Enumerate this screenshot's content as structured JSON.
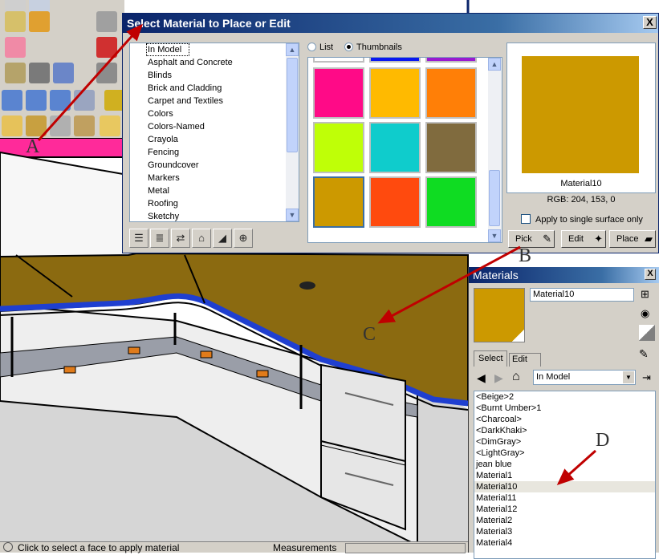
{
  "dialog": {
    "title": "Select Material to Place or Edit",
    "close_label": "X",
    "view_mode": {
      "list_label": "List",
      "thumbnails_label": "Thumbnails",
      "selected": "Thumbnails"
    },
    "categories": [
      "In Model",
      "Asphalt and Concrete",
      "Blinds",
      "Brick and Cladding",
      "Carpet and Textiles",
      "Colors",
      "Colors-Named",
      "Crayola",
      "Fencing",
      "Groundcover",
      "Markers",
      "Metal",
      "Roofing",
      "Sketchy"
    ],
    "selected_category": "In Model",
    "swatches": [
      {
        "color": "#ff0a87"
      },
      {
        "color": "#ffba00"
      },
      {
        "color": "#ff7f07"
      },
      {
        "color": "#bfff07"
      },
      {
        "color": "#0fcccc"
      },
      {
        "color": "#806b3e"
      },
      {
        "color": "#cc9900",
        "selected": true
      },
      {
        "color": "#ff4a0e"
      },
      {
        "color": "#0fdc22"
      }
    ],
    "preview": {
      "name": "Material10",
      "rgb": "RGB: 204, 153, 0",
      "color": "#cc9900"
    },
    "apply_single_label": "Apply to single surface only",
    "pick_label": "Pick",
    "edit_label": "Edit",
    "place_label": "Place"
  },
  "materials_panel": {
    "title": "Materials",
    "close_label": "X",
    "name_value": "Material10",
    "swatch_color": "#cc9900",
    "tabs": [
      {
        "label": "Select",
        "active": true
      },
      {
        "label": "Edit",
        "active": false
      }
    ],
    "collection": "In Model",
    "items": [
      "<Beige>2",
      "<Burnt Umber>1",
      "<Charcoal>",
      "<DarkKhaki>",
      "<DimGray>",
      "<LightGray>",
      "jean blue",
      "Material1",
      "Material10",
      "Material11",
      "Material12",
      "Material2",
      "Material3",
      "Material4"
    ],
    "selected_item": "Material10"
  },
  "status_bar": {
    "message": "Click to select a face to apply material",
    "measurements_label": "Measurements"
  },
  "annotations": [
    "A",
    "B",
    "C",
    "D"
  ],
  "icons": {
    "toolbar": [
      "select-icon",
      "paint-bucket-icon",
      "orbit-icon",
      "zoom-icon",
      "walk-icon",
      "house-icon",
      "eraser-icon",
      "move-icon",
      "box-icon",
      "component-icon",
      "tape-icon"
    ],
    "dialog_tools": [
      "list-view-icon",
      "details-icon",
      "swap-icon",
      "home-icon",
      "display-icon",
      "add-material-icon"
    ],
    "panel": [
      "create-material-icon",
      "sample-paint-icon",
      "back-icon",
      "forward-icon",
      "home-icon",
      "details-arrow-icon",
      "eyedropper-icon"
    ]
  },
  "colors": {
    "title_start": "#0a246a",
    "title_end": "#a6caf0",
    "countertop": "#8b6a10",
    "edge": "#1f3fd0",
    "arrow": "#c00000"
  }
}
